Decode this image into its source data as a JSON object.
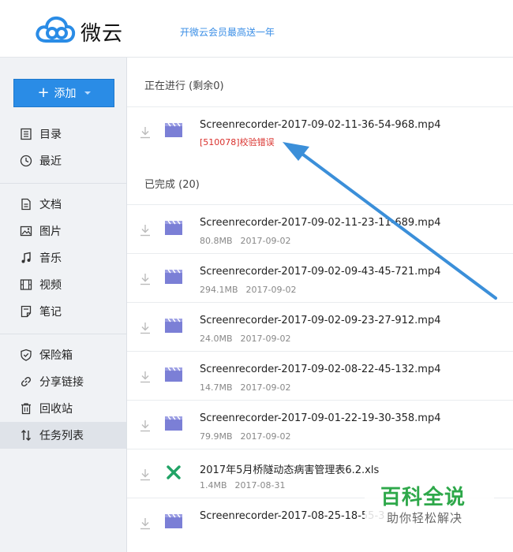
{
  "header": {
    "brand": "微云",
    "promo": "开微云会员最高送一年"
  },
  "sidebar": {
    "add_label": "添加",
    "items": [
      {
        "label": "目录",
        "icon": "list-icon"
      },
      {
        "label": "最近",
        "icon": "clock-icon"
      },
      {
        "label": "文档",
        "icon": "document-icon"
      },
      {
        "label": "图片",
        "icon": "image-icon"
      },
      {
        "label": "音乐",
        "icon": "music-icon"
      },
      {
        "label": "视频",
        "icon": "video-icon"
      },
      {
        "label": "笔记",
        "icon": "note-icon"
      },
      {
        "label": "保险箱",
        "icon": "shield-icon"
      },
      {
        "label": "分享链接",
        "icon": "link-icon"
      },
      {
        "label": "回收站",
        "icon": "trash-icon"
      },
      {
        "label": "任务列表",
        "icon": "sort-icon"
      }
    ]
  },
  "main": {
    "in_progress_title": "正在进行 (剩余0)",
    "in_progress": [
      {
        "name": "Screenrecorder-2017-09-02-11-36-54-968.mp4",
        "error": "[510078]校验错误",
        "type": "video"
      }
    ],
    "completed_title": "已完成 (20)",
    "completed": [
      {
        "name": "Screenrecorder-2017-09-02-11-23-11-689.mp4",
        "size": "80.8MB",
        "date": "2017-09-02",
        "type": "video"
      },
      {
        "name": "Screenrecorder-2017-09-02-09-43-45-721.mp4",
        "size": "294.1MB",
        "date": "2017-09-02",
        "type": "video"
      },
      {
        "name": "Screenrecorder-2017-09-02-09-23-27-912.mp4",
        "size": "24.0MB",
        "date": "2017-09-02",
        "type": "video"
      },
      {
        "name": "Screenrecorder-2017-09-02-08-22-45-132.mp4",
        "size": "14.7MB",
        "date": "2017-09-02",
        "type": "video"
      },
      {
        "name": "Screenrecorder-2017-09-01-22-19-30-358.mp4",
        "size": "79.9MB",
        "date": "2017-09-02",
        "type": "video"
      },
      {
        "name": "2017年5月桥隧动态病害管理表6.2.xls",
        "size": "1.4MB",
        "date": "2017-08-31",
        "type": "excel"
      },
      {
        "name": "Screenrecorder-2017-08-25-18-55-3",
        "size": "",
        "date": "",
        "type": "video"
      }
    ]
  },
  "watermark": {
    "line1": "百科全说",
    "line2": "助你轻松解决"
  },
  "colors": {
    "accent": "#2a8ce6",
    "error": "#d9302c",
    "video_icon": "#7b7fd6",
    "excel_icon": "#21a366",
    "arrow": "#3b8fd9",
    "watermark_green": "#2ea84a"
  }
}
